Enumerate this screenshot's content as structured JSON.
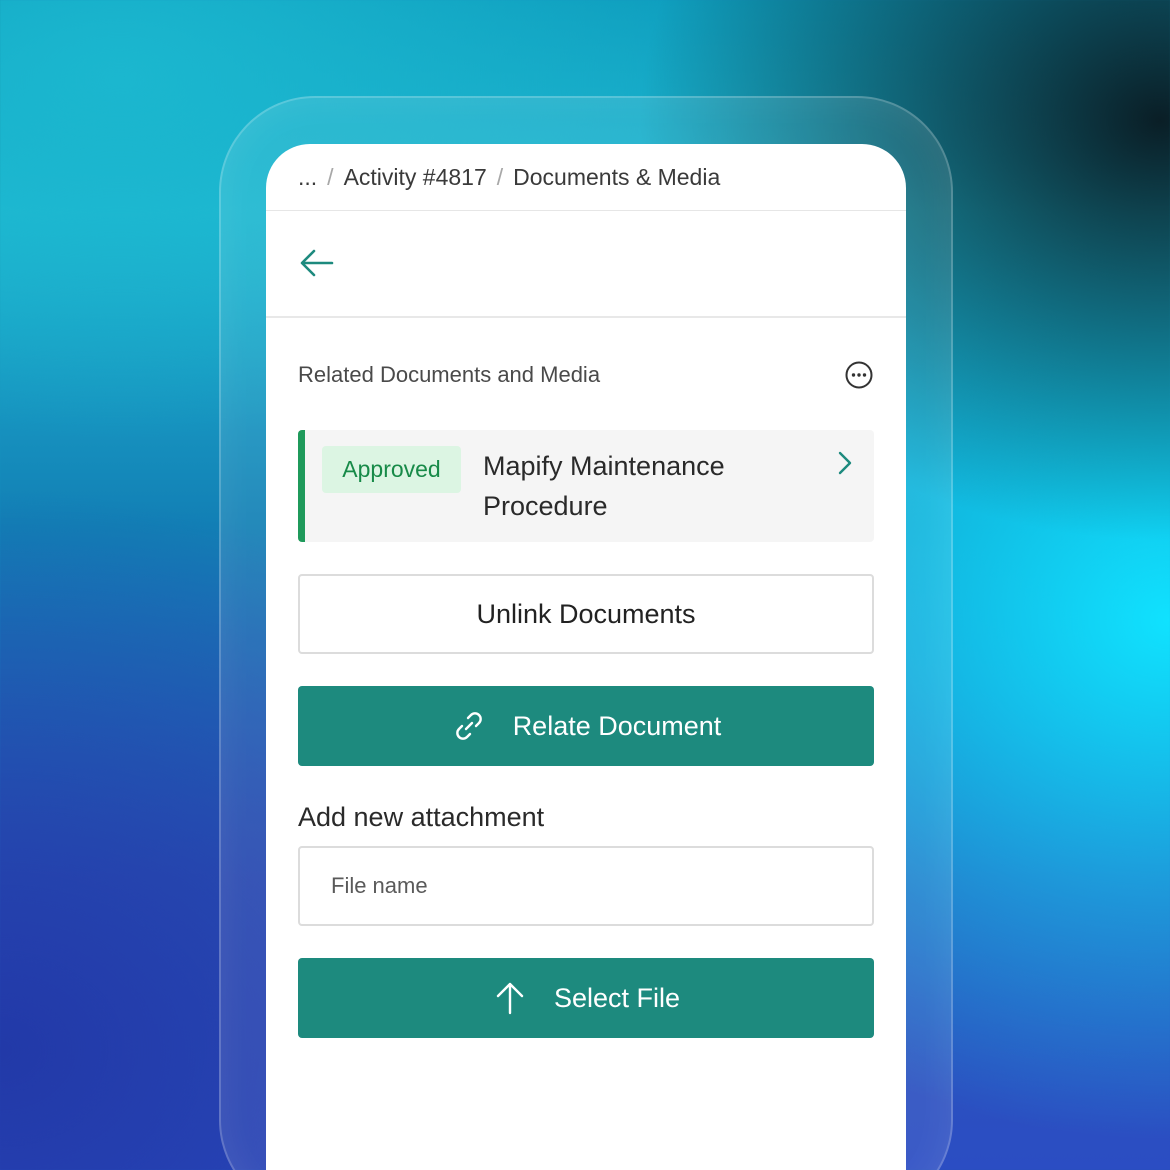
{
  "breadcrumb": {
    "items": [
      "...",
      "Activity #4817",
      "Documents & Media"
    ]
  },
  "header": {
    "back_icon": "arrow-left-icon"
  },
  "section": {
    "title": "Related Documents and Media",
    "menu_icon": "more-horizontal-circle-icon"
  },
  "document": {
    "status": "Approved",
    "title": "Mapify Maintenance Procedure",
    "chevron_icon": "chevron-right-icon"
  },
  "actions": {
    "unlink_label": "Unlink Documents",
    "relate_label": "Relate Document",
    "relate_icon": "link-icon"
  },
  "attachment": {
    "label": "Add new attachment",
    "placeholder": "File name",
    "select_label": "Select File",
    "select_icon": "arrow-up-icon"
  },
  "colors": {
    "primary": "#1d8a7e",
    "approved_bg": "#dcf5e3",
    "approved_text": "#178a48",
    "approved_border": "#1f9a5b"
  }
}
